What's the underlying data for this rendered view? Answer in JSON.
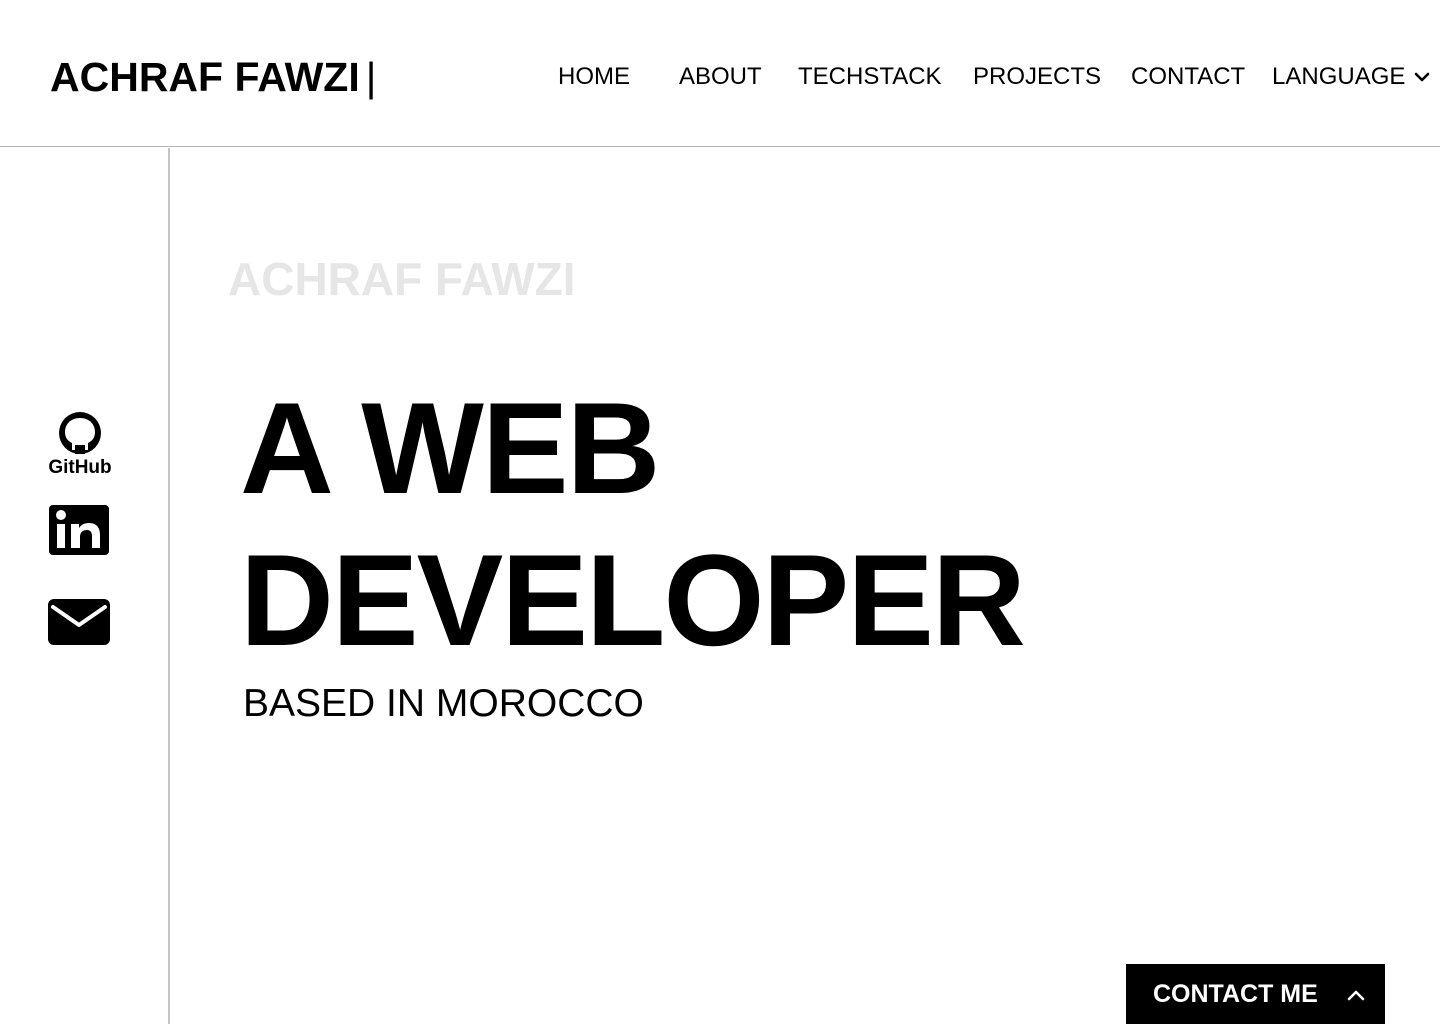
{
  "header": {
    "logo": "ACHRAF FAWZI",
    "logo_cursor": "|",
    "nav": {
      "home": "HOME",
      "about": "ABOUT",
      "techstack": "TECHSTACK",
      "projects": "PROJECTS",
      "contact": "CONTACT",
      "language": "LANGUAGE"
    }
  },
  "social": {
    "github_label": "GitHub",
    "github_icon": "github-icon",
    "linkedin_icon": "linkedin-icon",
    "email_icon": "mail-icon"
  },
  "hero": {
    "name": "ACHRAF FAWZI",
    "title_line1": "A WEB",
    "title_line2": "DEVELOPER",
    "subtitle": "BASED IN MOROCCO"
  },
  "contact_button": {
    "label": "CONTACT ME",
    "icon": "chevron-up-icon"
  },
  "colors": {
    "text": "#000000",
    "faded_name": "#e6e6e6",
    "divider": "#c4c4c4",
    "button_bg": "#000000",
    "button_text": "#ffffff"
  }
}
